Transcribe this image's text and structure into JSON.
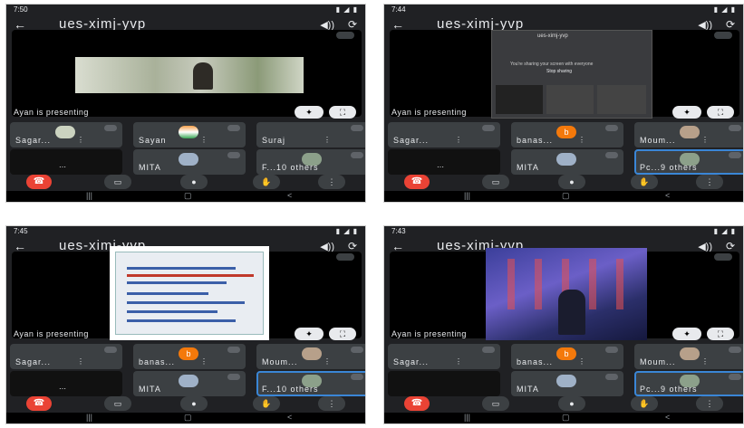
{
  "screens": [
    {
      "time": "7:50",
      "meeting_title": "ues-ximj-yvp",
      "presenting_label": "Ayan is presenting",
      "participants": [
        "Sagar...",
        "Sayan",
        "Suraj",
        "",
        "MITA",
        "F...10 others"
      ]
    },
    {
      "time": "7:44",
      "meeting_title": "ues-ximj-yvp",
      "presenting_label": "Ayan is presenting",
      "share_title": "ues-ximj-yvp",
      "share_msg": "You're sharing your screen with everyone",
      "stop_label": "Stop sharing",
      "participants": [
        "Sagar...",
        "banas...",
        "Moum...",
        "",
        "MITA",
        "Pc...9 others"
      ],
      "avatar_letter": "b"
    },
    {
      "time": "7:45",
      "meeting_title": "ues-ximj-yvp",
      "presenting_label": "Ayan is presenting",
      "participants": [
        "Sagar...",
        "banas...",
        "Moum...",
        "",
        "MITA",
        "F...10 others"
      ],
      "avatar_letter": "b"
    },
    {
      "time": "7:43",
      "meeting_title": "ues-ximj-yvp",
      "presenting_label": "Ayan is presenting",
      "participants": [
        "Sagar...",
        "banas...",
        "Moum...",
        "",
        "MITA",
        "Pc...9 others"
      ],
      "avatar_letter": "b"
    }
  ],
  "icons": {
    "back": "arrow-left-icon",
    "speaker": "speaker-icon",
    "camera_switch": "camera-switch-icon",
    "end_call": "end-call-icon",
    "video": "video-icon",
    "mic": "mic-icon",
    "hand": "raise-hand-icon",
    "more": "more-options-icon"
  },
  "colors": {
    "background": "#202124",
    "end_call": "#ea4335",
    "avatar_orange": "#f4790b",
    "highlight": "#3a86d6"
  }
}
